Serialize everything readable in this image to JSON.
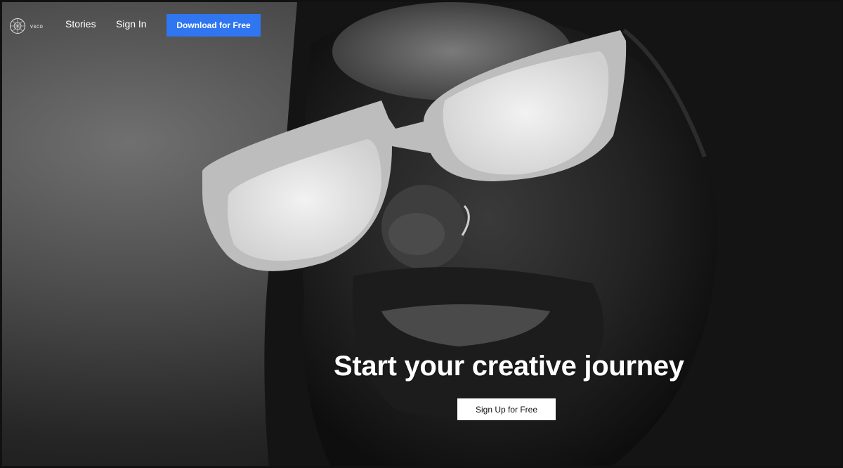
{
  "nav": {
    "logo_text": "vsco",
    "links": [
      {
        "label": "Stories"
      },
      {
        "label": "Sign In"
      }
    ],
    "download_label": "Download for Free",
    "download_color": "#2f76f0"
  },
  "hero": {
    "headline": "Start your creative journey",
    "signup_label": "Sign Up for Free"
  }
}
